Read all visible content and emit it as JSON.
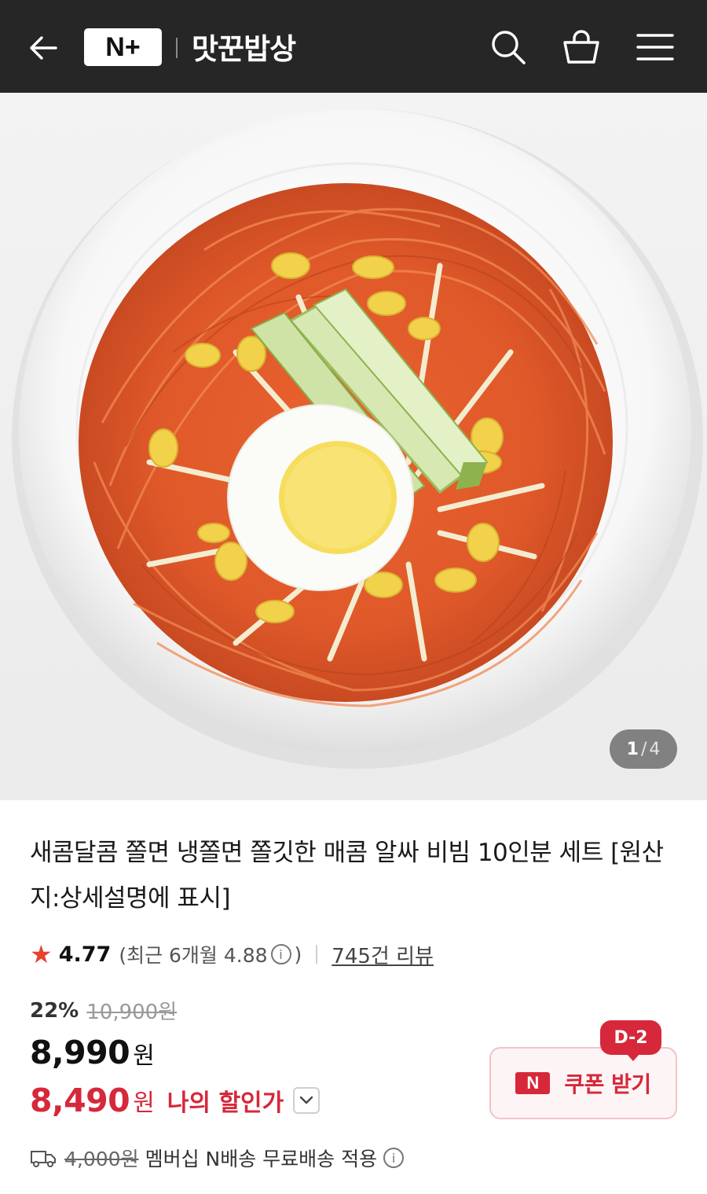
{
  "header": {
    "back_icon": "arrow-left-icon",
    "logo_text": "N+",
    "brand_name": "맛꾼밥상",
    "icons": [
      "search-icon",
      "shopping-basket-icon",
      "menu-icon"
    ],
    "background": "#262626"
  },
  "gallery": {
    "current": "1",
    "separator": "/",
    "total": "4"
  },
  "product": {
    "title": "새콤달콤 쫄면 냉쫄면 쫄깃한 매콤 알싸 비빔 10인분 세트 [원산지:상세설명에 표시]",
    "rating": {
      "star_icon": "star-icon",
      "score": "4.77",
      "recent_text": "(최근 6개월 4.88",
      "recent_close": ")",
      "info_icon": "ⓘ",
      "review_count": "745건 리뷰"
    },
    "discount_rate": "22%",
    "original_price": "10,900원",
    "price": "8,990",
    "price_unit": "원",
    "my_price": "8,490",
    "my_price_unit": "원",
    "my_price_label": "나의 할인가",
    "coupon": {
      "dday": "D-2",
      "badge": "N",
      "label": "쿠폰 받기"
    },
    "shipping": {
      "original_fee": "4,000원",
      "text": "멤버십 N배송 무료배송 적용"
    }
  },
  "colors": {
    "accent": "#d6283a",
    "star": "#e8432e"
  }
}
